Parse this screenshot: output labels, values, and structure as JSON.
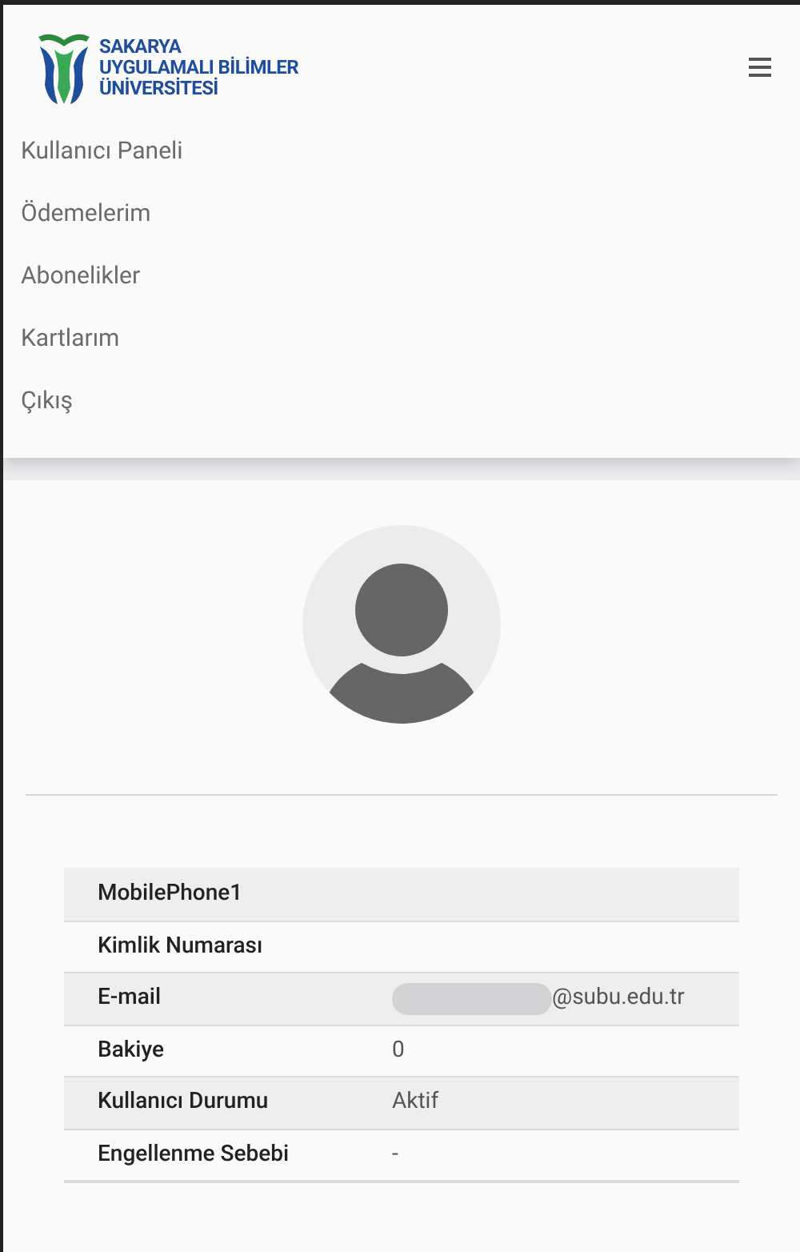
{
  "logo": {
    "lines": [
      "SAKARYA",
      "UYGULAMALI BİLİMLER",
      "ÜNİVERSİTESİ"
    ]
  },
  "nav": {
    "expanded": true,
    "items": [
      "Kullanıcı Paneli",
      "Ödemelerim",
      "Abonelikler",
      "Kartlarım",
      "Çıkış"
    ]
  },
  "details": [
    {
      "label": "MobilePhone1",
      "value_redacted": false
    },
    {
      "label": "Kimlik Numarası",
      "value_redacted": false
    },
    {
      "label": "E-mail",
      "value": "@subu.edu.tr",
      "value_redacted": true
    },
    {
      "label": "Bakiye",
      "value": "0",
      "value_redacted": false
    },
    {
      "label": "Kullanıcı Durumu",
      "value": "Aktif",
      "value_redacted": false
    },
    {
      "label": "Engellenme Sebebi",
      "value": "-",
      "value_redacted": false
    }
  ]
}
